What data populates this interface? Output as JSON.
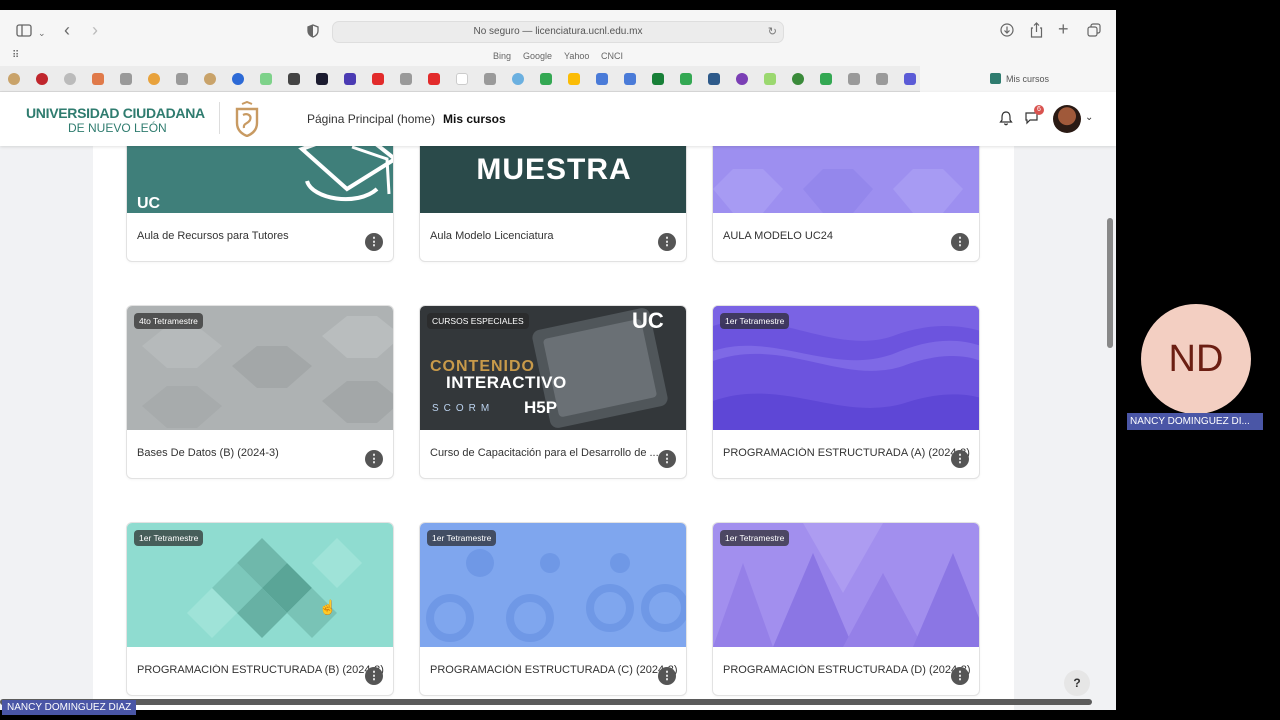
{
  "browser": {
    "url": "No seguro — licenciatura.ucnl.edu.mx",
    "favorites": [
      "Bing",
      "Google",
      "Yahoo",
      "CNCI"
    ],
    "active_tab_label": "Mis cursos"
  },
  "header": {
    "logo_line1": "UNIVERSIDAD CIUDADANA",
    "logo_line2": "DE NUEVO LEÓN",
    "nav": [
      "Página Principal (home)",
      "Mis cursos"
    ],
    "message_count": "6"
  },
  "courses": [
    {
      "title": "Aula de Recursos para Tutores",
      "badge": "",
      "image_text": "UC"
    },
    {
      "title": "Aula Modelo Licenciatura",
      "badge": "",
      "image_text": "MUESTRA"
    },
    {
      "title": "AULA MODELO UC24",
      "badge": "",
      "image_text": ""
    },
    {
      "title": "Bases De Datos (B) (2024-3)",
      "badge": "4to Tetramestre",
      "image_text": ""
    },
    {
      "title": "Curso de Capacitación para el Desarrollo de ...",
      "badge": "CURSOS ESPECIALES",
      "image_text": [
        "CONTENIDO",
        "INTERACTIVO",
        "SCORM",
        "H5P",
        "UC"
      ]
    },
    {
      "title": "PROGRAMACIÓN ESTRUCTURADA (A) (2024-3)",
      "badge": "1er Tetramestre",
      "image_text": ""
    },
    {
      "title": "PROGRAMACIÓN ESTRUCTURADA (B) (2024-3)",
      "badge": "1er Tetramestre",
      "image_text": ""
    },
    {
      "title": "PROGRAMACIÓN ESTRUCTURADA (C) (2024-3)",
      "badge": "1er Tetramestre",
      "image_text": ""
    },
    {
      "title": "PROGRAMACIÓN ESTRUCTURADA (D) (2024-3)",
      "badge": "1er Tetramestre",
      "image_text": ""
    }
  ],
  "help_label": "?",
  "call": {
    "participant_initials": "ND",
    "participant_name": "NANCY DOMINGUEZ DI...",
    "speaker_name": "NANCY DOMINGUEZ DIAZ"
  },
  "colors": {
    "brand_green": "#2f7c6f",
    "call_label_bg": "#4a56a6"
  }
}
